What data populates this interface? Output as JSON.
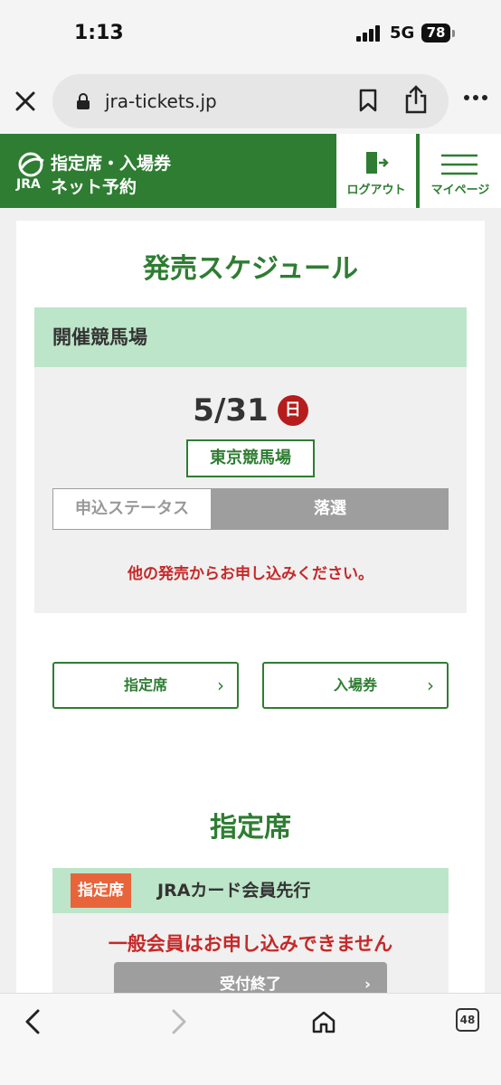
{
  "status_bar": {
    "time": "1:13",
    "network": "5G",
    "battery": "78"
  },
  "browser": {
    "url": "jra-tickets.jp",
    "tab_count": "48"
  },
  "header": {
    "logo_line1": "指定席・入場券",
    "logo_line2": "ネット予約",
    "logo_mark": "JRA",
    "logout_label": "ログアウト",
    "mypage_label": "マイページ",
    "brand_color": "#2e7d32"
  },
  "schedule": {
    "title": "発売スケジュール",
    "venue_header": "開催競馬場",
    "date": "5/31",
    "day_of_week": "日",
    "racecourse": "東京競馬場",
    "status_label": "申込ステータス",
    "status_value": "落選",
    "message": "他の発売からお申し込みください。"
  },
  "nav": {
    "reserved_label": "指定席",
    "admission_label": "入場券"
  },
  "reserved": {
    "title": "指定席",
    "tag": "指定席",
    "plan_name": "JRAカード会員先行",
    "message": "一般会員はお申し込みできません",
    "button_label": "受付終了"
  }
}
